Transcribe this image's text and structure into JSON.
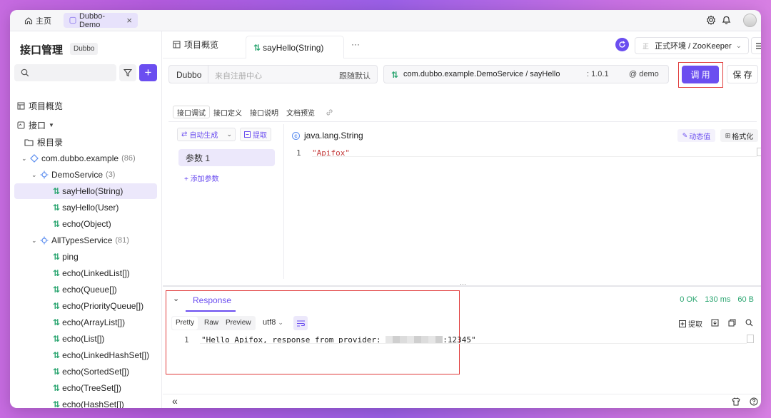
{
  "titlebar": {
    "home_tab": "主页",
    "project_tab": "Dubbo-Demo",
    "close_glyph": "×"
  },
  "sidebar": {
    "title": "接口管理",
    "badge": "Dubbo",
    "add_glyph": "+",
    "overview": "项目概览",
    "interface": "接口",
    "root": "根目录",
    "package": "com.dubbo.example",
    "package_count": "(86)",
    "service1": "DemoService",
    "service1_count": "(3)",
    "methods1": [
      "sayHello(String)",
      "sayHello(User)",
      "echo(Object)"
    ],
    "service2": "AllTypesService",
    "service2_count": "(81)",
    "methods2": [
      "ping",
      "echo(LinkedList[])",
      "echo(Queue[])",
      "echo(PriorityQueue[])",
      "echo(ArrayList[])",
      "echo(List[])",
      "echo(LinkedHashSet[])",
      "echo(SortedSet[])",
      "echo(TreeSet[])",
      "echo(HashSet[])"
    ],
    "arrow_glyph": "⇅"
  },
  "tabs": {
    "overview": "项目概览",
    "active": "sayHello(String)",
    "more": "···"
  },
  "env": {
    "prefix": "正",
    "label": "正式环境 / ZooKeeper"
  },
  "request": {
    "protocol": "Dubbo",
    "registry_placeholder": "来自注册中心",
    "balance": "跟随默认",
    "path": "com.dubbo.example.DemoService / sayHello",
    "version": ": 1.0.1",
    "group": "@ demo",
    "invoke_btn": "调 用",
    "save_btn": "保 存"
  },
  "subtabs": [
    "接口调试",
    "接口定义",
    "接口说明",
    "文档预览"
  ],
  "params": {
    "auto_gen": "自动生成",
    "extract": "提取",
    "param1": "参数 1",
    "add_param": "+ 添加参数",
    "type_label": "java.lang.String",
    "dynamic_btn": "动态值",
    "format_btn": "格式化",
    "line_no": "1",
    "code": "\"Apifox\""
  },
  "response": {
    "tab": "Response",
    "status": "0 OK",
    "time": "130 ms",
    "size": "60 B",
    "modes": [
      "Pretty",
      "Raw",
      "Preview"
    ],
    "encoding": "utf8",
    "extract": "提取",
    "line_no": "1",
    "body_prefix": "\"Hello Apifox, response from provider: ",
    "body_suffix": ":12345\""
  },
  "footer": {
    "collapse": "«"
  },
  "colors": {
    "accent": "#6b4ef0",
    "ok_green": "#2aa570",
    "red_frame": "#e03b3b",
    "string_red": "#c43b3b"
  }
}
